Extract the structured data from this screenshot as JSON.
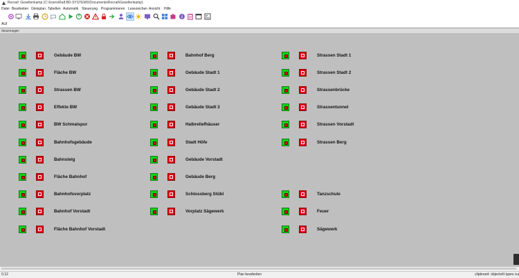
{
  "window": {
    "title": "Rocrail: Gesellenkamp (C:\\Users\\Ralf.BD-SYSTEMS\\Documents\\Rocrail\\Gesellenkamp)",
    "app_icon": "rocrail-logo-icon"
  },
  "menu": [
    {
      "label": "Datei"
    },
    {
      "label": "Bearbeiten"
    },
    {
      "label": "Gleisplan"
    },
    {
      "label": "Tabellen"
    },
    {
      "label": "Automatik"
    },
    {
      "label": "Steuerung"
    },
    {
      "label": "Programmieren"
    },
    {
      "label": "Lesezeichen"
    },
    {
      "label": "Ansicht"
    },
    {
      "label": "Hilfe"
    }
  ],
  "toolbar": {
    "buttons": [
      {
        "icon": "gear-icon",
        "color": "#b04dc8"
      },
      {
        "icon": "monitor-icon",
        "color": "#7d7d7d"
      },
      {
        "icon": "download-icon",
        "color": "#3a7bd5"
      },
      {
        "icon": "printer-icon",
        "color": "#555555"
      },
      {
        "icon": "clock-icon",
        "color": "#d4a017"
      },
      {
        "icon": "throttle-icon",
        "color": "#8aa0b8"
      },
      {
        "icon": "home-icon",
        "color": "#2aa84a"
      },
      {
        "icon": "play-icon",
        "color": "#2aa84a"
      },
      {
        "icon": "power-icon",
        "color": "#2aa84a"
      },
      {
        "icon": "stop-icon",
        "color": "#d82020"
      },
      {
        "icon": "warning-icon",
        "color": "#d82020"
      },
      {
        "icon": "lock-icon",
        "color": "#d82020"
      },
      {
        "icon": "arrow-icon",
        "color": "#2aa84a"
      },
      {
        "icon": "person-icon",
        "color": "#7c5cc4"
      },
      {
        "icon": "eye-icon",
        "color": "#3a7bd5"
      },
      {
        "icon": "sun-icon",
        "color": "#f0b400"
      },
      {
        "icon": "display-icon",
        "color": "#7c5cc4"
      },
      {
        "icon": "zoom-icon",
        "color": "#444444"
      },
      {
        "icon": "grid-icon",
        "color": "#3a7bd5"
      },
      {
        "icon": "puzzle-icon",
        "color": "#c03a8a"
      },
      {
        "icon": "info-icon",
        "color": "#7c5cc4"
      },
      {
        "icon": "clipboard-icon",
        "color": "#c03a8a"
      },
      {
        "icon": "window-icon",
        "color": "#444444"
      },
      {
        "icon": "checklist-icon",
        "color": "#444444"
      }
    ],
    "active_index": 14
  },
  "tabs": [
    {
      "label": "AUI"
    }
  ],
  "panel": {
    "title": "Steuerungen",
    "background": "#bfbfbf",
    "indicator_on_color": "#17d21c",
    "indicator_off_color": "#e0001a"
  },
  "columns": [
    {
      "items": [
        {
          "label": "Gebäude BW"
        },
        {
          "label": "Fläche BW"
        },
        {
          "label": "Strassen BW"
        },
        {
          "label": "Effekte BW"
        },
        {
          "label": "BW Schmalspur"
        },
        {
          "label": "Bahnhofsgebäude"
        },
        {
          "label": "Bahnsteig"
        },
        {
          "label": "Fläche Bahnhof"
        },
        {
          "label": "Bahnhofsvorplatz"
        },
        {
          "label": "Bahnhof Vorstadt"
        },
        {
          "label": "Fläche Bahnhof Vorstadt"
        }
      ]
    },
    {
      "items": [
        {
          "label": "Bahnhof Berg"
        },
        {
          "label": "Gebäude Stadt 1"
        },
        {
          "label": "Gebäude Stadt 2"
        },
        {
          "label": "Gebäude Stadt 3"
        },
        {
          "label": "Halbreliefhäuser"
        },
        {
          "label": "Stadt Höfe"
        },
        {
          "label": "Gebäude Vorstadt"
        },
        {
          "label": "Gebäude Berg"
        },
        {
          "label": "Schlossberg Stübl"
        },
        {
          "label": "Vorplatz Sägewerk"
        }
      ]
    },
    {
      "items": [
        {
          "label": "Strassen Stadt 1"
        },
        {
          "label": "Strassen Stadt 2"
        },
        {
          "label": "Strassenbrücke"
        },
        {
          "label": "Strassentunnel"
        },
        {
          "label": "Strassen Vorstadt"
        },
        {
          "label": "Strassen Berg"
        },
        {
          "label": "Tanzschule"
        },
        {
          "label": "Feuer"
        },
        {
          "label": "Sägewerk"
        }
      ]
    }
  ],
  "status": {
    "left": "0.12",
    "center": "Plan bearbeiten",
    "right": "clipboard: objects/tt types cur"
  }
}
